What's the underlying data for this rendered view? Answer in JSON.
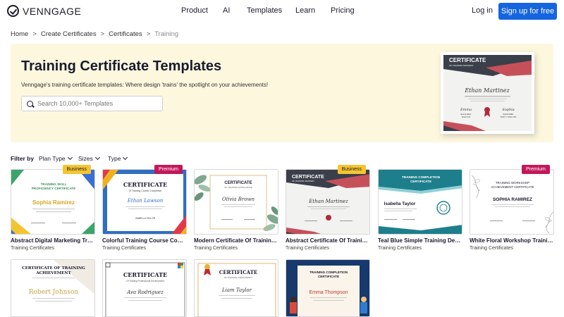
{
  "header": {
    "logo_text": "VENNGAGE",
    "nav": [
      "Product",
      "AI",
      "Templates",
      "Learn",
      "Pricing"
    ],
    "login": "Log in",
    "signup": "Sign up for free"
  },
  "breadcrumb": {
    "items": [
      "Home",
      "Create Certificates",
      "Certificates"
    ],
    "current": "Training",
    "separator": ">"
  },
  "hero": {
    "title": "Training Certificate Templates",
    "subtitle": "Venngage's training certificate templates: Where design 'trains' the spotlight on your achievements!",
    "search_placeholder": "Search 10,000+ Templates",
    "preview": {
      "heading": "CERTIFICATE",
      "subheading": "OF TRAINING MASTERY",
      "name": "Ethan Martinez",
      "signer1": "Emma Davis",
      "signer2": "Sophia Miller",
      "role1": "DIRECTOR",
      "role2": "DEPUTY DIRECTOR"
    }
  },
  "filters": {
    "label": "Filter by",
    "options": [
      "Plan Type",
      "Sizes",
      "Type"
    ]
  },
  "cards": [
    {
      "title": "Abstract Digital Marketing Trai...",
      "category": "Training Certificates",
      "badge": "Business",
      "heading": "TRAINING SKILL PROFICIENCY CERTIFICATE",
      "name": "Sophia Ramirez"
    },
    {
      "title": "Colorful Training Course Comp...",
      "category": "Training Certificates",
      "badge": "Premium",
      "heading": "CERTIFICATE",
      "subheading": "Of Training Course Completion",
      "name": "Ethan Lawson",
      "signer": "ISABELLA TAYLOR"
    },
    {
      "title": "Modern Certificate Of Training...",
      "category": "Training Certificates",
      "badge": "",
      "heading": "CERTIFICATE",
      "subheading": "OF TRAINING EXCELLENCE",
      "name": "Olivia Brown"
    },
    {
      "title": "Abstract Certificate Of Trainin...",
      "category": "Training Certificates",
      "badge": "Business",
      "heading": "CERTIFICATE",
      "subheading": "OF TRAINING MASTERY",
      "name": "Ethan Martinez"
    },
    {
      "title": "Teal Blue Simple Training Desi...",
      "category": "Training Certificates",
      "badge": "",
      "heading": "TRAINING COMPLETION CERTIFICATE",
      "name": "Isabella Taylor"
    },
    {
      "title": "White Floral Workshop Trainin...",
      "category": "Training Certificates",
      "badge": "Premium",
      "heading": "TRAINING WORKSHOP ACHIEVEMENT CERTIFICATE",
      "name": "SOPHIA RAMIREZ"
    }
  ],
  "cards_row2": [
    {
      "heading": "CERTIFICATE OF TRAINING ACHIEVEMENT",
      "name": "Robert Johnson"
    },
    {
      "heading": "CERTIFICATE",
      "subheading": "Of Training Professional Development",
      "name": "Ava Rodriguez"
    },
    {
      "heading": "CERTIFICATE",
      "subheading": "OF TRAINING PROFICIENCY",
      "name": "Liam Taylor"
    },
    {
      "heading": "TRAINING COMPLETION CERTIFICATE",
      "name": "Emma Thompson"
    }
  ],
  "colors": {
    "brand_blue": "#1565e0",
    "hero_bg": "#fdf7de",
    "business_badge": "#f5c530",
    "premium_badge": "#c2185b"
  }
}
